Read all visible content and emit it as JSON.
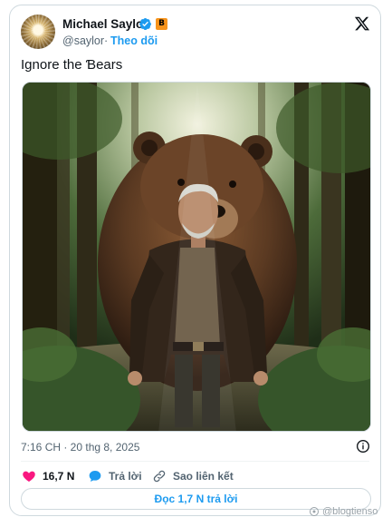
{
  "author": {
    "name": "Michael Saylor",
    "handle": "@saylor",
    "follow_label": "Theo dõi",
    "separator": "·",
    "badge_symbol": "B"
  },
  "tweet": {
    "text": "Ignore the Ɓears",
    "timestamp": "7:16 CH · 20 thg 8, 2025"
  },
  "media": {
    "description_icon": "image"
  },
  "actions": {
    "like_count": "16,7 N",
    "reply_label": "Trả lời",
    "copy_link_label": "Sao liên kết",
    "read_replies_label": "Đọc 1,7 N trả lời"
  },
  "watermark": {
    "text": "@blogtienso"
  },
  "colors": {
    "accent": "#1d9bf0",
    "like": "#f91880",
    "bitcoin": "#f7931a",
    "muted": "#536471"
  }
}
